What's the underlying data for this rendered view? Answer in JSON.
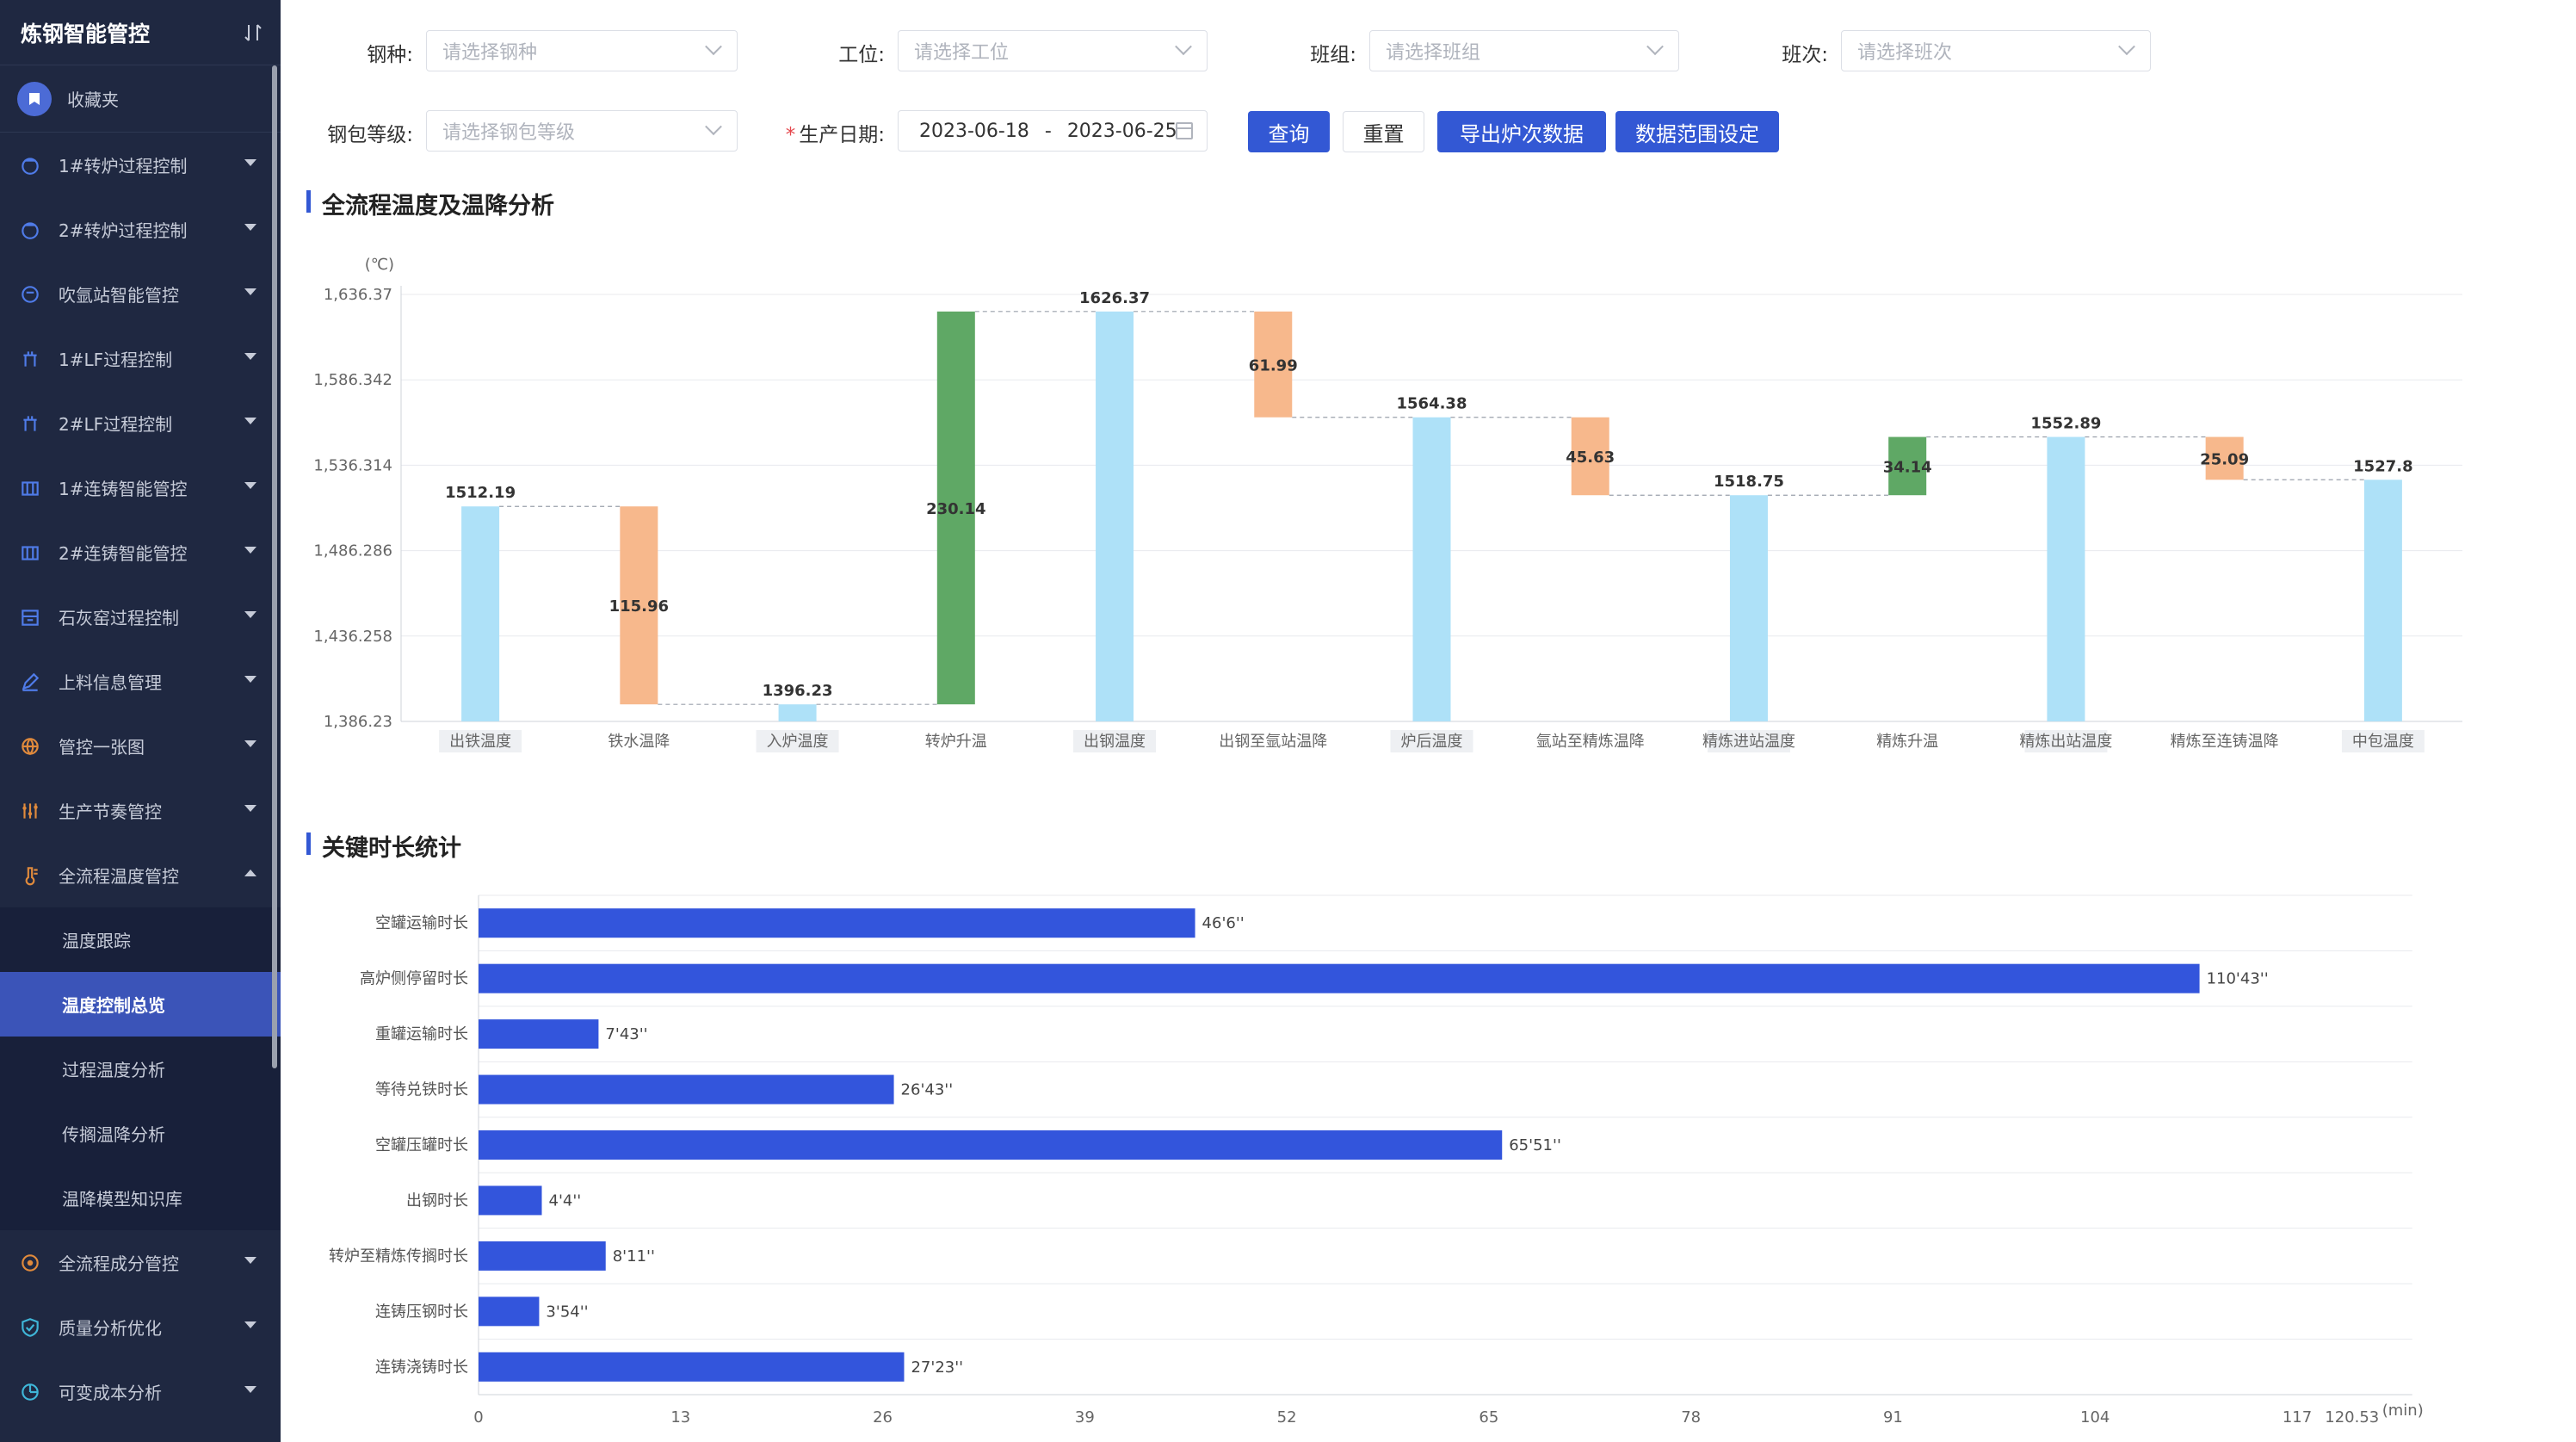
{
  "sidebar": {
    "title": "炼钢智能管控",
    "favorites": "收藏夹",
    "items": [
      {
        "label": "1#转炉过程控制",
        "icon": "converter-icon"
      },
      {
        "label": "2#转炉过程控制",
        "icon": "converter-icon"
      },
      {
        "label": "吹氩站智能管控",
        "icon": "argon-icon"
      },
      {
        "label": "1#LF过程控制",
        "icon": "ladle-furnace-icon"
      },
      {
        "label": "2#LF过程控制",
        "icon": "ladle-furnace-icon"
      },
      {
        "label": "1#连铸智能管控",
        "icon": "caster-icon"
      },
      {
        "label": "2#连铸智能管控",
        "icon": "caster-icon"
      },
      {
        "label": "石灰窑过程控制",
        "icon": "kiln-icon"
      },
      {
        "label": "上料信息管理",
        "icon": "edit-icon"
      },
      {
        "label": "管控一张图",
        "icon": "globe-icon"
      },
      {
        "label": "生产节奏管控",
        "icon": "sliders-icon"
      },
      {
        "label": "全流程温度管控",
        "icon": "thermometer-icon",
        "expanded": true
      }
    ],
    "sub_items": [
      "温度跟踪",
      "温度控制总览",
      "过程温度分析",
      "传搁温降分析",
      "温降模型知识库"
    ],
    "active_sub": "温度控制总览",
    "bottom_items": [
      {
        "label": "全流程成分管控",
        "icon": "composition-icon"
      },
      {
        "label": "质量分析优化",
        "icon": "shield-icon"
      },
      {
        "label": "可变成本分析",
        "icon": "pie-icon"
      }
    ]
  },
  "filters": {
    "steel_grade": {
      "label": "钢种:",
      "placeholder": "请选择钢种"
    },
    "station": {
      "label": "工位:",
      "placeholder": "请选择工位"
    },
    "team": {
      "label": "班组:",
      "placeholder": "请选择班组"
    },
    "shift": {
      "label": "班次:",
      "placeholder": "请选择班次"
    },
    "ladle_grade": {
      "label": "钢包等级:",
      "placeholder": "请选择钢包等级"
    },
    "date": {
      "label": "生产日期:",
      "required_mark": "*",
      "start": "2023-06-18",
      "separator": "-",
      "end": "2023-06-25"
    }
  },
  "buttons": {
    "query": "查询",
    "reset": "重置",
    "export": "导出炉次数据",
    "range": "数据范围设定"
  },
  "colors": {
    "accent": "#3358d4",
    "bar_base": "#aee1f8",
    "bar_drop": "#f7b88c",
    "bar_rise": "#5fa865",
    "hbar": "#3355dc"
  },
  "chart_data": [
    {
      "type": "bar",
      "variant": "waterfall",
      "title": "全流程温度及温降分析",
      "ylabel": "(℃)",
      "ylim": [
        1386.23,
        1636.37
      ],
      "yticks": [
        "1,386.23",
        "1,436.258",
        "1,486.286",
        "1,536.314",
        "1,586.342",
        "1,636.37"
      ],
      "grid": true,
      "categories": [
        "出铁温度",
        "铁水温降",
        "入炉温度",
        "转炉升温",
        "出钢温度",
        "出钢至氩站温降",
        "炉后温度",
        "氩站至精炼温降",
        "精炼进站温度",
        "精炼升温",
        "精炼出站温度",
        "精炼至连铸温降",
        "中包温度"
      ],
      "kinds": [
        "base",
        "drop",
        "base",
        "rise",
        "base",
        "drop",
        "base",
        "drop",
        "base",
        "rise",
        "base",
        "drop",
        "base"
      ],
      "labels": [
        "1512.19",
        "115.96",
        "1396.23",
        "230.14",
        "1626.37",
        "61.99",
        "1564.38",
        "45.63",
        "1518.75",
        "34.14",
        "1552.89",
        "25.09",
        "1527.8"
      ],
      "values": [
        1512.19,
        115.96,
        1396.23,
        230.14,
        1626.37,
        61.99,
        1564.38,
        45.63,
        1518.75,
        34.14,
        1552.89,
        25.09,
        1527.8
      ]
    },
    {
      "type": "bar",
      "orientation": "horizontal",
      "title": "关键时长统计",
      "xlabel": "(min)",
      "xlim": [
        0,
        120.53
      ],
      "xticks": [
        "0",
        "13",
        "26",
        "39",
        "52",
        "65",
        "78",
        "91",
        "104",
        "117",
        "120.53"
      ],
      "tickvalues": [
        0,
        13,
        26,
        39,
        52,
        65,
        78,
        91,
        104,
        117,
        120.53
      ],
      "grid": true,
      "categories": [
        "空罐运输时长",
        "高炉侧停留时长",
        "重罐运输时长",
        "等待兑铁时长",
        "空罐压罐时长",
        "出钢时长",
        "转炉至精炼传搁时长",
        "连铸压钢时长",
        "连铸浇铸时长"
      ],
      "labels": [
        "46'6''",
        "110'43''",
        "7'43''",
        "26'43''",
        "65'51''",
        "4'4''",
        "8'11''",
        "3'54''",
        "27'23''"
      ],
      "values": [
        46.1,
        110.72,
        7.72,
        26.72,
        65.85,
        4.07,
        8.18,
        3.9,
        27.38
      ]
    }
  ]
}
